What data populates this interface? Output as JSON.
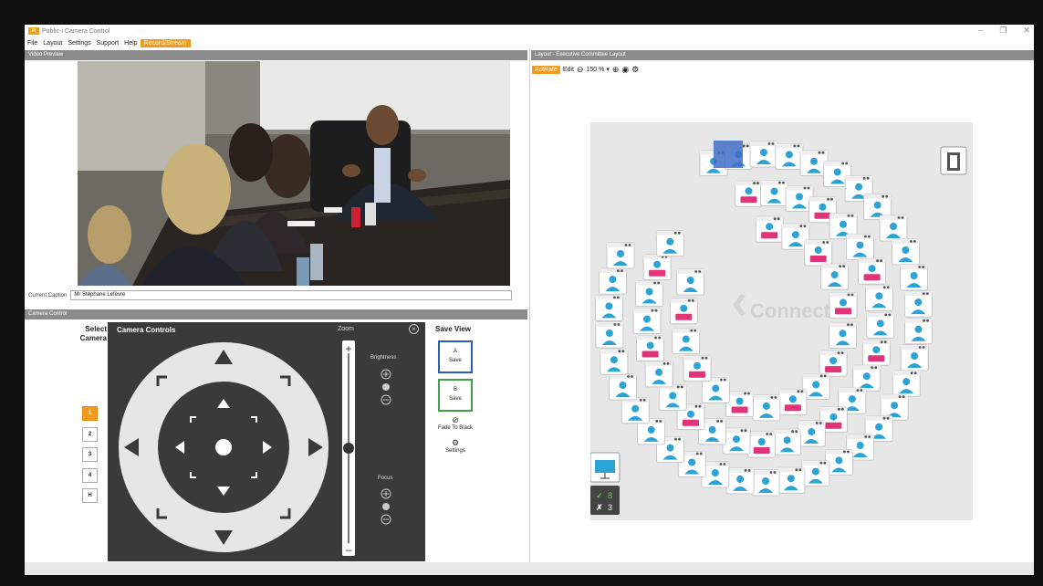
{
  "app": {
    "title": "Public-i Camera Control"
  },
  "menu": [
    "File",
    "Layout",
    "Settings",
    "Support",
    "Help",
    "Record/Stream"
  ],
  "video_panel": {
    "title": "Video Preview"
  },
  "caption": {
    "label": "Current Caption",
    "value": "Mr Stéphane Lefèvre"
  },
  "camera_control": {
    "title": "Camera Control",
    "select_camera_label": "Select Camera",
    "cameras": [
      "1",
      "2",
      "3",
      "4",
      "H"
    ],
    "active_camera": "1",
    "panel_title": "Camera Controls",
    "zoom_label": "Zoom",
    "brightness_label": "Brightness",
    "focus_label": "Focus",
    "zoom_level": 0.5
  },
  "save_view": {
    "title": "Save View",
    "a_label": "A",
    "a_action": "Save",
    "b_label": "B",
    "b_action": "Save",
    "fade_label": "Fade To Black",
    "settings_label": "Settings",
    "a_color": "#2b5fb8",
    "b_color": "#3ea04a"
  },
  "layout_panel": {
    "title": "Layout - Executive Committee Layout",
    "activate": "Activate",
    "edit": "Edit",
    "zoom": "150 %",
    "watermark": "Connect",
    "vote_for": "8",
    "vote_against": "3"
  },
  "colors": {
    "accent": "#f29a1f",
    "seat_blue": "#2ba3d6",
    "seat_pink": "#e0337a",
    "panel_dark": "#3a3a3a"
  }
}
